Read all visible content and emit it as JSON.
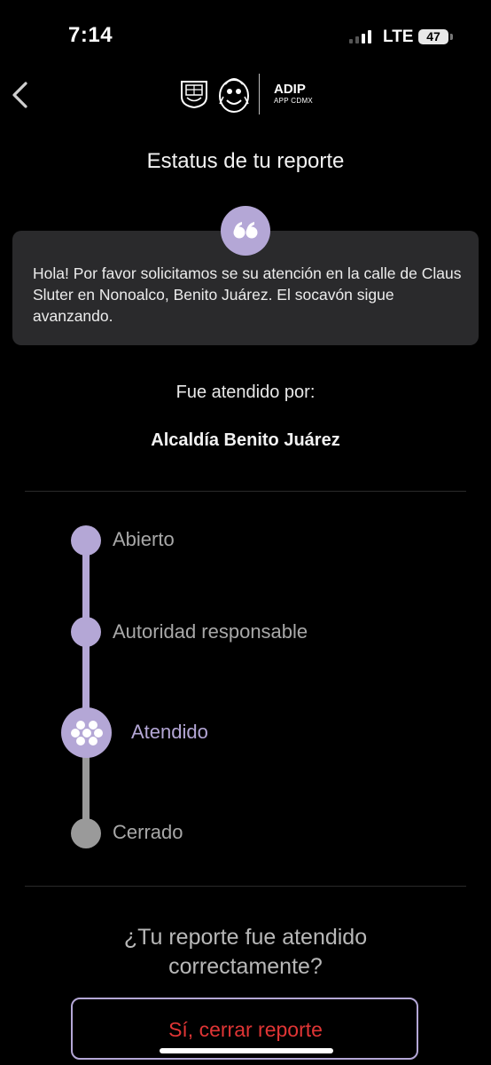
{
  "status_bar": {
    "time": "7:14",
    "network": "LTE",
    "battery": "47"
  },
  "header": {
    "org_name": "ADIP",
    "org_sub": "APP CDMX",
    "logos": [
      "cdmx-crest-icon",
      "cdmx-seal-icon"
    ]
  },
  "page": {
    "title": "Estatus de tu reporte"
  },
  "report": {
    "message": "Hola! Por favor solicitamos se su atención en la calle de Claus Sluter en Nonoalco, Benito Juárez. El socavón sigue avanzando.",
    "handled_label": "Fue atendido por:",
    "handled_by": "Alcaldía Benito Juárez"
  },
  "timeline": {
    "steps": [
      {
        "label": "Abierto",
        "state": "done"
      },
      {
        "label": "Autoridad responsable",
        "state": "done"
      },
      {
        "label": "Atendido",
        "state": "current"
      },
      {
        "label": "Cerrado",
        "state": "pending"
      }
    ]
  },
  "feedback": {
    "question": "¿Tu reporte fue atendido correctamente?",
    "close_button": "Sí, cerrar reporte"
  },
  "colors": {
    "accent": "#b4a7d6",
    "pending": "#9a9a9a",
    "danger": "#e03535",
    "card": "#2a2a2c"
  }
}
